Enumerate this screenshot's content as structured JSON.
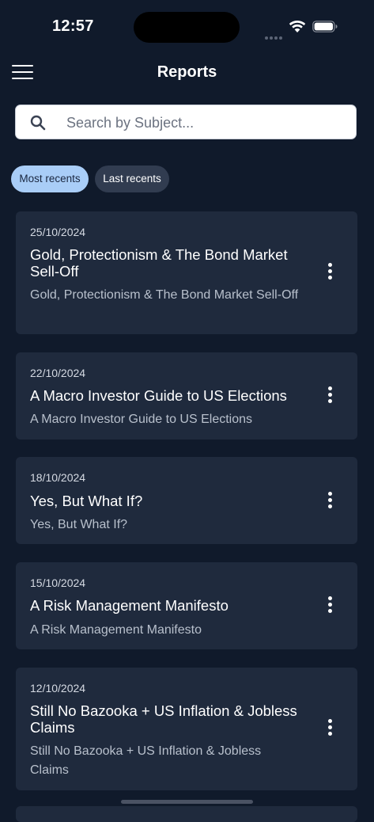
{
  "status_bar": {
    "time": "12:57"
  },
  "header": {
    "title": "Reports"
  },
  "search": {
    "placeholder": "Search by Subject...",
    "value": ""
  },
  "filters": [
    {
      "label": "Most recents",
      "active": true
    },
    {
      "label": "Last recents",
      "active": false
    }
  ],
  "reports": [
    {
      "date": "25/10/2024",
      "title": "Gold, Protectionism & The Bond Market Sell-Off",
      "subtitle": "Gold, Protectionism & The Bond Market Sell-Off"
    },
    {
      "date": "22/10/2024",
      "title": "A Macro Investor Guide to US Elections",
      "subtitle": "A Macro Investor Guide to US Elections"
    },
    {
      "date": "18/10/2024",
      "title": "Yes, But What If?",
      "subtitle": "Yes, But What If?"
    },
    {
      "date": "15/10/2024",
      "title": "A Risk Management Manifesto",
      "subtitle": "A Risk Management Manifesto"
    },
    {
      "date": "12/10/2024",
      "title": "Still No Bazooka + US Inflation & Jobless Claims",
      "subtitle": "Still No Bazooka + US Inflation & Jobless Claims"
    }
  ],
  "colors": {
    "background": "#101a2b",
    "card": "#1f2a3d",
    "chip_active": "#a9cdf7",
    "chip_inactive": "#313c50"
  },
  "icons": {
    "menu": "hamburger-menu-icon",
    "search": "search-icon",
    "more": "more-vertical-icon",
    "wifi": "wifi-icon",
    "battery": "battery-icon",
    "signal": "signal-icon"
  }
}
